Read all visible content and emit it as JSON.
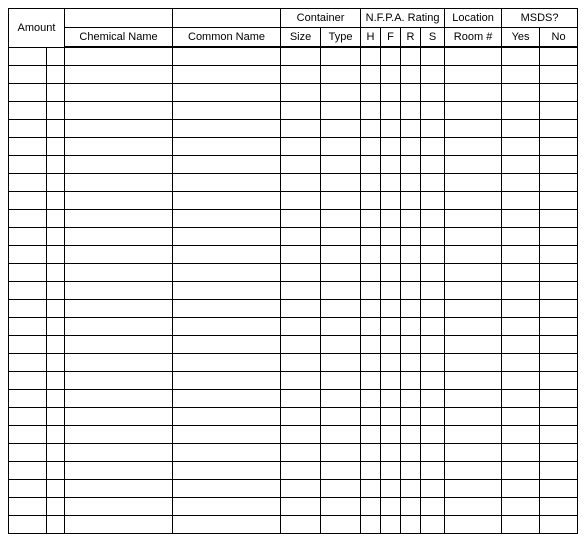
{
  "headers": {
    "amount": "Amount",
    "chemical_name": "Chemical Name",
    "common_name": "Common Name",
    "container": "Container",
    "size": "Size",
    "type": "Type",
    "nfpa": "N.F.P.A. Rating",
    "h": "H",
    "f": "F",
    "r": "R",
    "s": "S",
    "location": "Location",
    "room": "Room #",
    "msds": "MSDS?",
    "yes": "Yes",
    "no": "No"
  },
  "row_count": 27
}
